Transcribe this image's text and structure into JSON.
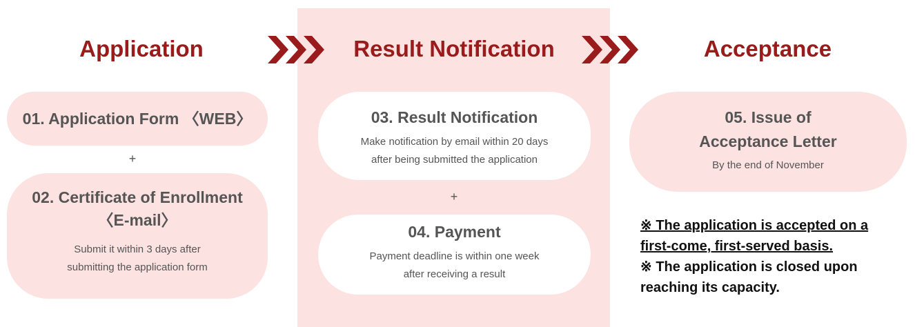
{
  "colors": {
    "accent": "#9a1b1b",
    "pink": "#fde2e2",
    "text": "#555555"
  },
  "headings": {
    "application": "Application",
    "result": "Result Notification",
    "acceptance": "Acceptance"
  },
  "icons": [
    "chevrons-right-icon",
    "chevrons-right-icon"
  ],
  "steps": {
    "s1": {
      "title": "01. Application Form 〈WEB〉"
    },
    "s2": {
      "title_line1": "02. Certificate of Enrollment",
      "title_line2": "〈E-mail〉",
      "desc_line1": "Submit it within 3 days after",
      "desc_line2": "submitting the application form"
    },
    "s3": {
      "title": "03. Result Notification",
      "desc_line1": "Make notification by email within 20 days",
      "desc_line2": "after being submitted the application"
    },
    "s4": {
      "title": "04. Payment",
      "desc_line1": "Payment deadline is within one week",
      "desc_line2": "after receiving a result"
    },
    "s5": {
      "title_line1": "05. Issue of",
      "title_line2": "Acceptance Letter",
      "desc": "By the end of November"
    }
  },
  "plus": "+",
  "notes": {
    "n1_line1": "※ The application is accepted on a",
    "n1_line2": "first-come, first-served basis.",
    "n2_line1": "※ The application is closed upon",
    "n2_line2": "reaching its capacity."
  }
}
